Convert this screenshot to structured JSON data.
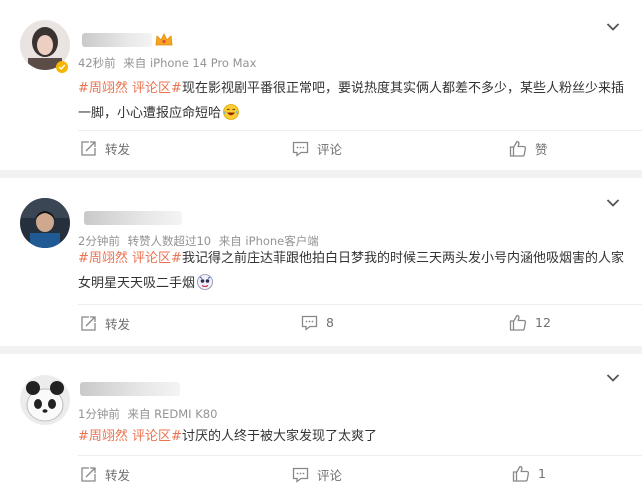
{
  "comments": [
    {
      "time": "42秒前",
      "source": "来自 iPhone 14 Pro Max",
      "tags": [
        "#周翊然",
        "评论区#"
      ],
      "text": "现在影视剧平番很正常吧，要说热度其实俩人都差不多少，某些人粉丝少来插一脚，小心遭报应命短哈",
      "emoji": "laughing-emoji",
      "repost_label": "转发",
      "comment_label": "评论",
      "like_label": "赞"
    },
    {
      "time": "2分钟前",
      "extra": "转赞人数超过10",
      "source": "来自 iPhone客户端",
      "tags": [
        "#周翊然",
        "评论区#"
      ],
      "text": "我记得之前庄达菲跟他拍白日梦我的时候三天两头发小号内涵他吸烟害的人家女明星天天吸二手烟",
      "emoji": "sticker-emoji",
      "repost_label": "转发",
      "comment_label": "8",
      "like_label": "12"
    },
    {
      "time": "1分钟前",
      "source": "来自 REDMI K80",
      "tags": [
        "#周翊然",
        "评论区#"
      ],
      "text": "讨厌的人终于被大家发现了太爽了",
      "repost_label": "转发",
      "comment_label": "评论",
      "like_label": "1"
    }
  ],
  "colors": {
    "tag": "#eb7350",
    "meta": "#939393",
    "background": "#f2f2f2",
    "verified": "#f7b500"
  },
  "icons": [
    "repost-icon",
    "comment-icon",
    "like-icon",
    "chevron-down-icon",
    "verified-badge-icon",
    "crown-icon"
  ]
}
